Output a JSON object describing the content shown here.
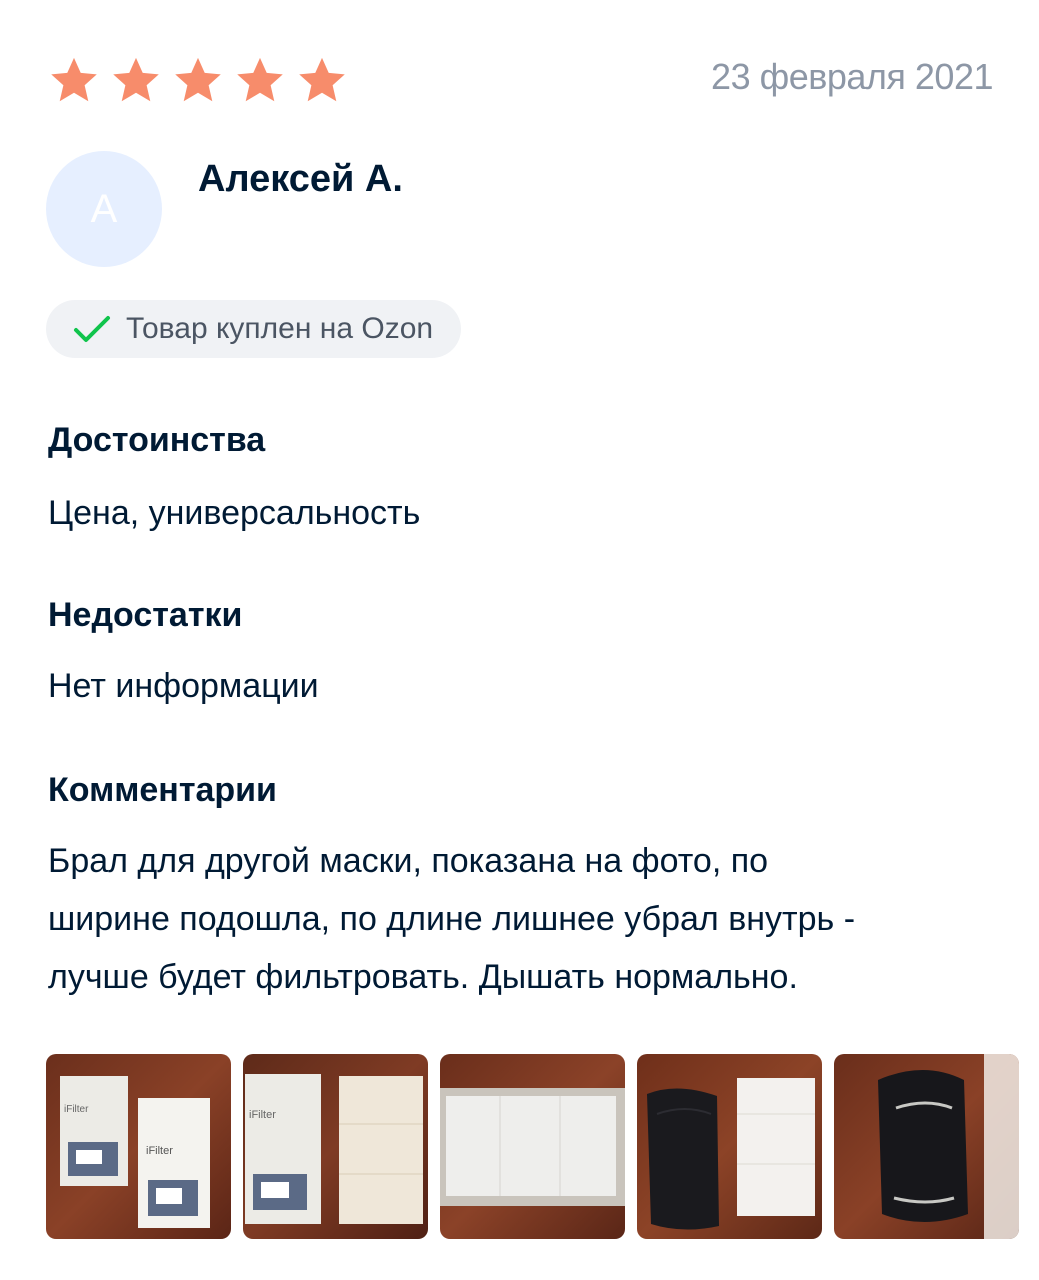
{
  "review": {
    "rating": 5,
    "rating_max": 5,
    "star_color": "#f78c6b",
    "date": "23 февраля 2021",
    "author": {
      "initial": "А",
      "name": "Алексей А."
    },
    "verified_badge": {
      "icon": "check-icon",
      "label": "Товар куплен на Ozon",
      "icon_color": "#10c44c"
    },
    "pros": {
      "title": "Достоинства",
      "text": "Цена, универсальность"
    },
    "cons": {
      "title": "Недостатки",
      "text": "Нет информации"
    },
    "comment": {
      "title": "Комментарии",
      "lines": [
        "Брал для другой маски, показана на фото, по",
        "ширине подошла, по длине лишнее убрал внутрь -",
        "лучше будет фильтровать. Дышать нормально."
      ]
    },
    "photos": [
      {
        "label": "photo-filter-packages",
        "package_text": "iFilter"
      },
      {
        "label": "photo-filter-sheet",
        "package_text": "iFilter"
      },
      {
        "label": "photo-filter-strip"
      },
      {
        "label": "photo-mask-and-filter"
      },
      {
        "label": "photo-mask-with-filter"
      }
    ]
  }
}
